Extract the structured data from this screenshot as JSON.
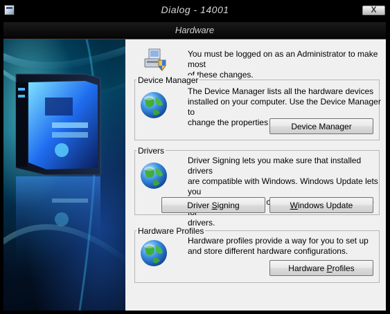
{
  "window": {
    "title": "Dialog -  14001",
    "close_label": "X"
  },
  "header": {
    "title": "Hardware"
  },
  "admin_notice": {
    "line1": "You must be logged on as an Administrator to make most",
    "line2": "of these changes."
  },
  "device_manager": {
    "group_label": "Device Manager",
    "lines": [
      "The Device Manager lists all the hardware devices",
      "installed on your computer. Use the Device Manager to",
      "change the properties of any device."
    ],
    "button": {
      "label": "Device Manager",
      "mnemonic": "",
      "rest": ""
    }
  },
  "drivers": {
    "group_label": "Drivers",
    "lines": [
      "Driver Signing lets you make sure that installed drivers",
      "are compatible with Windows. Windows Update lets you",
      "set up how Windows connects to Windows Update for",
      "drivers."
    ],
    "signing_button": {
      "before": "Driver ",
      "mnemonic": "S",
      "after": "igning"
    },
    "update_button": {
      "before": "",
      "mnemonic": "W",
      "after": "indows Update"
    }
  },
  "hardware_profiles": {
    "group_label": "Hardware Profiles",
    "lines": [
      "Hardware profiles provide a way for you to set up",
      "and store different hardware configurations."
    ],
    "button": {
      "before": "Hardware ",
      "mnemonic": "P",
      "after": "rofiles"
    }
  },
  "icons": {
    "app": "window-app-icon",
    "admin": "computer-admin-shield-icon",
    "globe": "globe-icon",
    "art": "computer-tower-illustration"
  }
}
